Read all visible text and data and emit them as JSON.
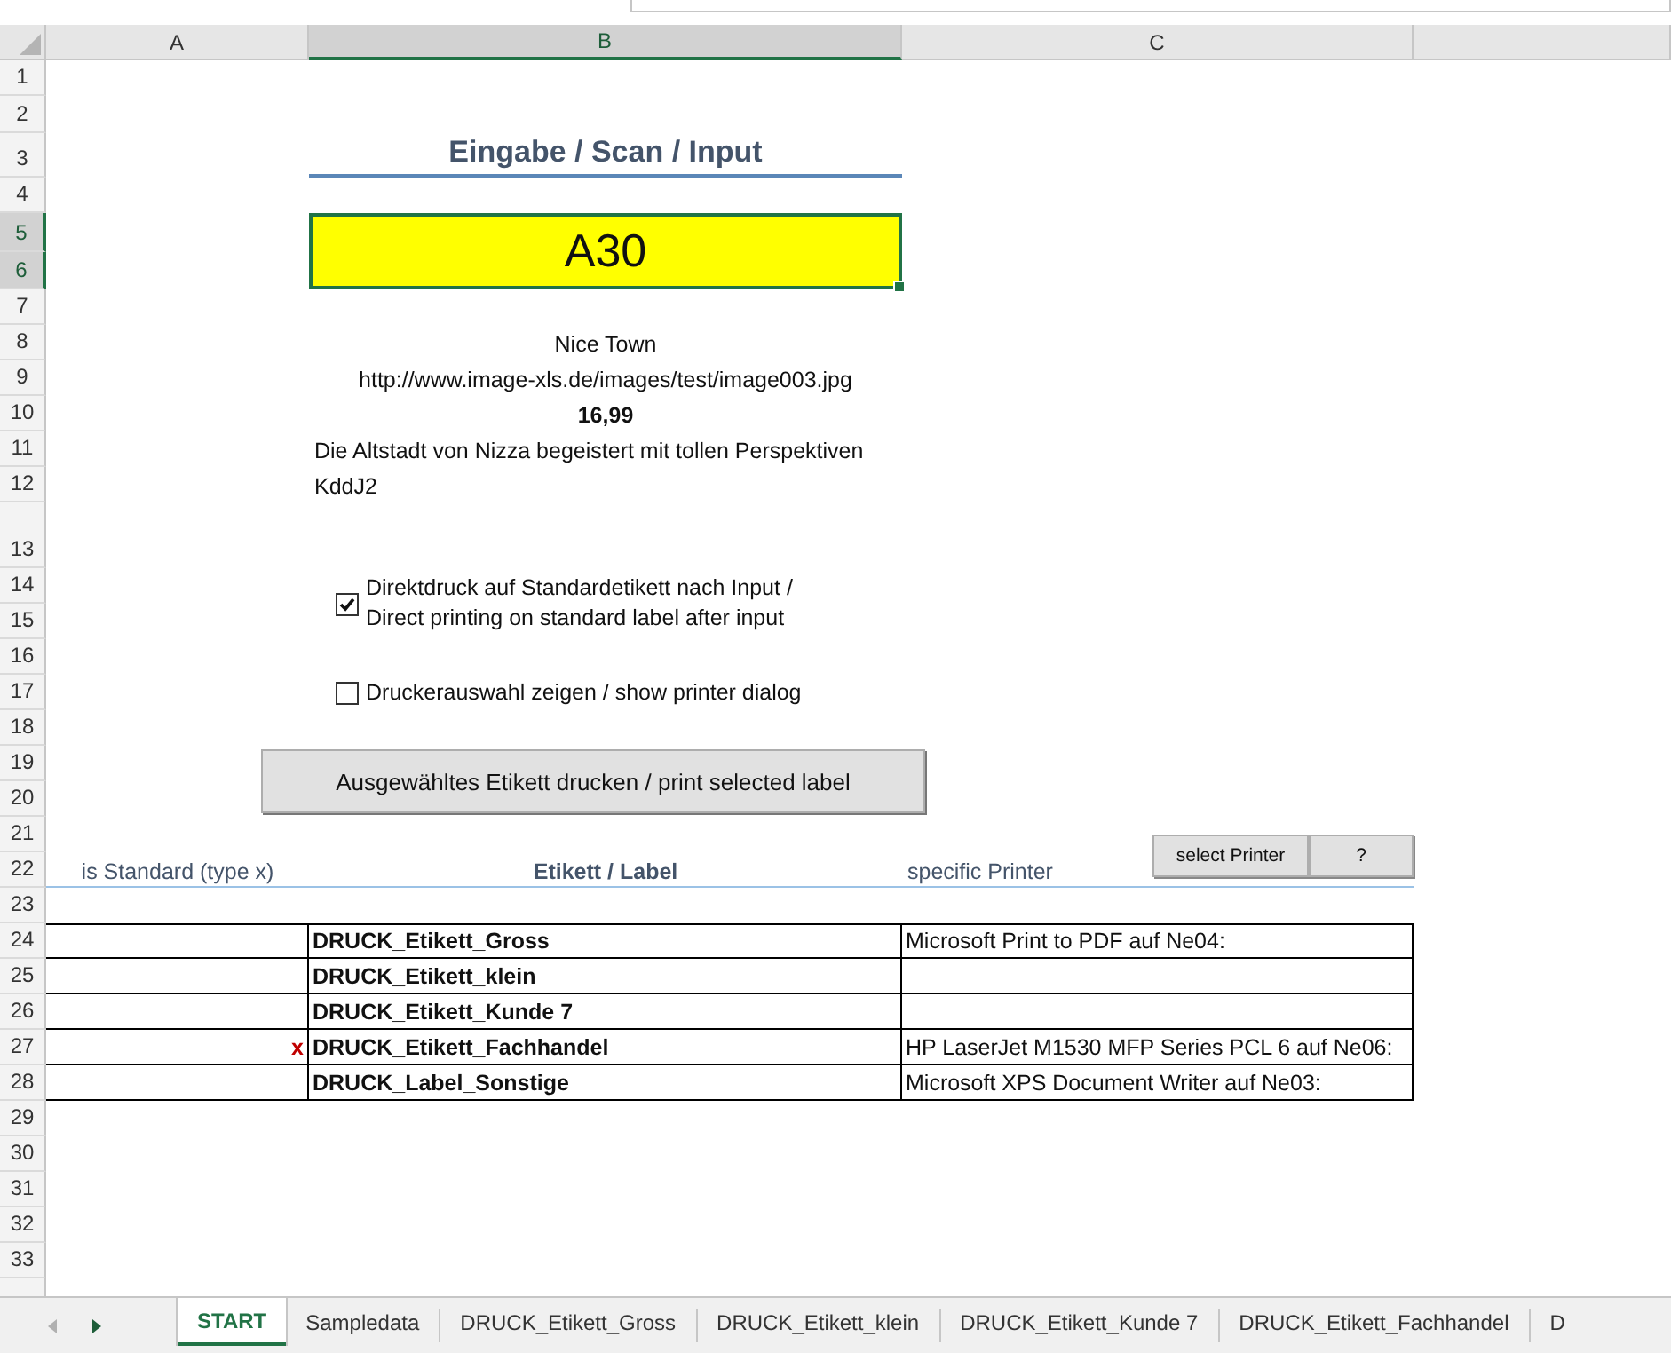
{
  "columns": [
    {
      "label": "A",
      "selected": false
    },
    {
      "label": "B",
      "selected": true
    },
    {
      "label": "C",
      "selected": false
    }
  ],
  "rows": [
    {
      "label": "1",
      "selected": false
    },
    {
      "label": "2",
      "selected": false
    },
    {
      "label": "3",
      "selected": false
    },
    {
      "label": "4",
      "selected": false
    },
    {
      "label": "5",
      "selected": true
    },
    {
      "label": "6",
      "selected": true
    },
    {
      "label": "7",
      "selected": false
    },
    {
      "label": "8",
      "selected": false
    },
    {
      "label": "9",
      "selected": false
    },
    {
      "label": "10",
      "selected": false
    },
    {
      "label": "11",
      "selected": false
    },
    {
      "label": "12",
      "selected": false
    },
    {
      "label": "13",
      "selected": false
    },
    {
      "label": "14",
      "selected": false
    },
    {
      "label": "15",
      "selected": false
    },
    {
      "label": "16",
      "selected": false
    },
    {
      "label": "17",
      "selected": false
    },
    {
      "label": "18",
      "selected": false
    },
    {
      "label": "19",
      "selected": false
    },
    {
      "label": "20",
      "selected": false
    },
    {
      "label": "21",
      "selected": false
    },
    {
      "label": "22",
      "selected": false
    },
    {
      "label": "23",
      "selected": false
    },
    {
      "label": "24",
      "selected": false
    },
    {
      "label": "25",
      "selected": false
    },
    {
      "label": "26",
      "selected": false
    },
    {
      "label": "27",
      "selected": false
    },
    {
      "label": "28",
      "selected": false
    },
    {
      "label": "29",
      "selected": false
    },
    {
      "label": "30",
      "selected": false
    },
    {
      "label": "31",
      "selected": false
    },
    {
      "label": "32",
      "selected": false
    },
    {
      "label": "33",
      "selected": false
    }
  ],
  "heading": "Eingabe / Scan / Input",
  "input_value": "A30",
  "details": {
    "title": "Nice Town",
    "url": "http://www.image-xls.de/images/test/image003.jpg",
    "price": "16,99",
    "description": "Die Altstadt von Nizza begeistert mit tollen Perspektiven",
    "code": "KddJ2"
  },
  "checkboxes": [
    {
      "label": "Direktdruck auf Standardetikett nach Input /\nDirect printing on standard label after input",
      "checked": true
    },
    {
      "label": "Druckerauswahl zeigen / show printer dialog",
      "checked": false
    }
  ],
  "print_button": "Ausgewähltes Etikett drucken / print selected label",
  "table": {
    "columns": [
      "is Standard (type x)",
      "Etikett / Label",
      "specific Printer"
    ],
    "buttons": [
      "select Printer",
      "?"
    ],
    "rows": [
      {
        "label": "DRUCK_Etikett_Gross",
        "printer": "Microsoft Print to PDF auf Ne04:"
      },
      {
        "label": "DRUCK_Etikett_klein"
      },
      {
        "label": "DRUCK_Etikett_Kunde 7"
      },
      {
        "standard": "x",
        "label": "DRUCK_Etikett_Fachhandel",
        "printer": "HP LaserJet M1530 MFP Series PCL 6 auf Ne06:"
      },
      {
        "label": "DRUCK_Label_Sonstige",
        "printer": "Microsoft XPS Document Writer auf Ne03:"
      }
    ]
  },
  "tabs": [
    {
      "label": "START",
      "selected": true
    },
    {
      "label": "Sampledata",
      "selected": false
    },
    {
      "label": "DRUCK_Etikett_Gross",
      "selected": false
    },
    {
      "label": "DRUCK_Etikett_klein",
      "selected": false
    },
    {
      "label": "DRUCK_Etikett_Kunde 7",
      "selected": false
    },
    {
      "label": "DRUCK_Etikett_Fachhandel",
      "selected": false
    },
    {
      "label": "D",
      "selected": false
    }
  ]
}
